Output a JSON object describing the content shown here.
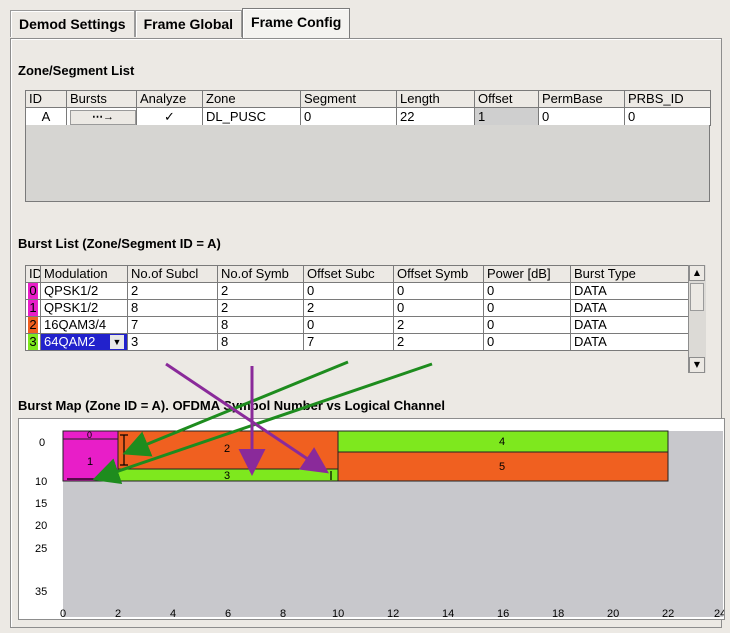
{
  "tabs": [
    "Demod Settings",
    "Frame Global",
    "Frame Config"
  ],
  "zone_list": {
    "title": "Zone/Segment List",
    "headers": [
      "ID",
      "Bursts",
      "Analyze",
      "Zone",
      "Segment",
      "Length",
      "Offset",
      "PermBase",
      "PRBS_ID"
    ],
    "row": {
      "id": "A",
      "bursts": "⋯→",
      "analyze": "✓",
      "zone": "DL_PUSC",
      "segment": "0",
      "length": "22",
      "offset": "1",
      "permbase": "0",
      "prbs_id": "0"
    }
  },
  "burst_list": {
    "title": "Burst List (Zone/Segment ID = A)",
    "headers": [
      "ID",
      "Modulation",
      "No.of Subcl",
      "No.of Symb",
      "Offset Subc",
      "Offset Symb",
      "Power [dB]",
      "Burst Type"
    ],
    "rows": [
      {
        "id": "0",
        "color": "#e81ec8",
        "modulation": "QPSK1/2",
        "subch": "2",
        "symb": "2",
        "off_subc": "0",
        "off_symb": "0",
        "power": "0",
        "type": "DATA"
      },
      {
        "id": "1",
        "color": "#e81ec8",
        "modulation": "QPSK1/2",
        "subch": "8",
        "symb": "2",
        "off_subc": "2",
        "off_symb": "0",
        "power": "0",
        "type": "DATA"
      },
      {
        "id": "2",
        "color": "#f06020",
        "modulation": "16QAM3/4",
        "subch": "7",
        "symb": "8",
        "off_subc": "0",
        "off_symb": "2",
        "power": "0",
        "type": "DATA"
      },
      {
        "id": "3",
        "color": "#7ee81e",
        "modulation": "64QAM2",
        "subch": "3",
        "symb": "8",
        "off_subc": "7",
        "off_symb": "2",
        "power": "0",
        "type": "DATA"
      }
    ]
  },
  "burst_map": {
    "title": "Burst Map (Zone ID = A). OFDMA Symbol Number vs Logical Channel",
    "y_ticks": [
      "0",
      "10",
      "15",
      "20",
      "25",
      "35"
    ],
    "x_ticks": [
      "0",
      "2",
      "4",
      "6",
      "8",
      "10",
      "12",
      "14",
      "16",
      "18",
      "20",
      "22",
      "24"
    ],
    "blocks": [
      {
        "label": "0",
        "color": "#e81ec8"
      },
      {
        "label": "1",
        "color": "#e81ec8"
      },
      {
        "label": "2",
        "color": "#f06020"
      },
      {
        "label": "3",
        "color": "#7ee81e"
      },
      {
        "label": "4",
        "color": "#7ee81e"
      },
      {
        "label": "5",
        "color": "#f06020"
      }
    ],
    "colors": {
      "magenta": "#e81ec8",
      "orange": "#f06020",
      "green": "#7ee81e",
      "grey": "#c8c8cc",
      "arrow_green": "#1e8c1e",
      "arrow_purple": "#8a2a9a"
    }
  }
}
